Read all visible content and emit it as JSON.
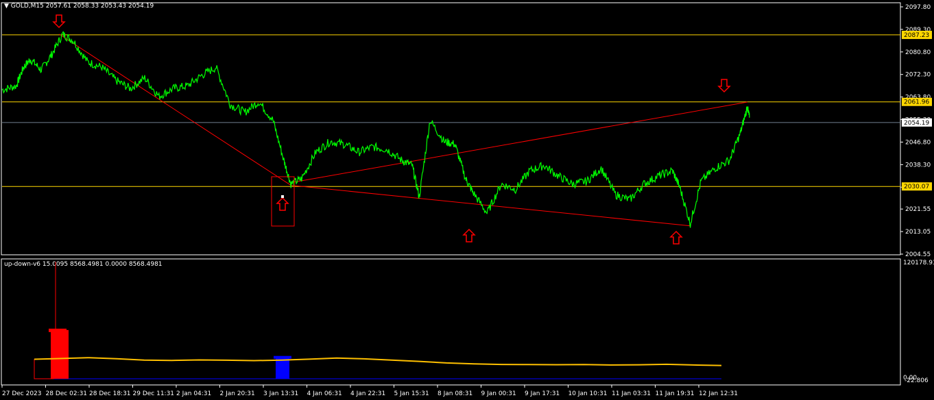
{
  "main_header": {
    "symbol": "GOLD,M15",
    "ohlc": "2057.61 2058.33 2053.43 2054.19"
  },
  "sub_header": {
    "indicator": "up-down-v6",
    "values": "15.0095 8568.4981 0.0000 8568.4981"
  },
  "colors": {
    "background": "#000000",
    "price_line": "#00ff00",
    "level_line": "#ffd700",
    "trend_line": "#ff0000",
    "arrow": "#ff0000",
    "current_price_line": "#708090",
    "ma_line": "#ffc000",
    "hist_up": "#ff0000",
    "hist_down": "#0000ff",
    "axis": "#ffffff"
  },
  "chart_data": [
    {
      "type": "line",
      "name": "main-price",
      "ylim": [
        2004.55,
        2097.8
      ],
      "y_ticks": [
        "2097.80",
        "2089.30",
        "2080.80",
        "2072.30",
        "2063.80",
        "2055.30",
        "2046.80",
        "2038.30",
        "2029.80",
        "2021.55",
        "2013.05",
        "2004.55"
      ],
      "x_ticks": [
        "27 Dec 2023",
        "28 Dec 02:31",
        "28 Dec 18:31",
        "29 Dec 11:31",
        "2 Jan 04:31",
        "2 Jan 20:31",
        "3 Jan 13:31",
        "4 Jan 06:31",
        "4 Jan 22:31",
        "5 Jan 15:31",
        "8 Jan 08:31",
        "9 Jan 00:31",
        "9 Jan 17:31",
        "10 Jan 10:31",
        "11 Jan 03:31",
        "11 Jan 19:31",
        "12 Jan 12:31"
      ],
      "x": [
        0,
        0.02,
        0.03,
        0.04,
        0.055,
        0.07,
        0.085,
        0.1,
        0.12,
        0.14,
        0.16,
        0.18,
        0.2,
        0.22,
        0.24,
        0.26,
        0.28,
        0.3,
        0.32,
        0.34,
        0.36,
        0.38,
        0.395,
        0.405,
        0.42,
        0.44,
        0.46,
        0.48,
        0.5,
        0.52,
        0.54,
        0.56,
        0.575,
        0.585,
        0.6,
        0.62,
        0.635,
        0.65,
        0.66,
        0.68,
        0.7,
        0.72,
        0.74,
        0.76,
        0.78,
        0.8,
        0.82,
        0.84,
        0.86,
        0.88,
        0.9,
        0.92,
        0.94,
        0.95,
        0.965,
        0.98,
        1.0,
        1.02,
        1.035,
        1.045,
        1.048
      ],
      "values": [
        2066.5,
        2068,
        2075,
        2078,
        2074,
        2080,
        2087.5,
        2085,
        2077,
        2075,
        2070,
        2067,
        2071,
        2064,
        2067,
        2068,
        2072,
        2075,
        2061,
        2058,
        2062,
        2055,
        2040,
        2031,
        2033,
        2043,
        2047,
        2046,
        2043,
        2045,
        2044,
        2040,
        2038,
        2026,
        2055,
        2047,
        2046,
        2033,
        2028,
        2020,
        2031,
        2029,
        2036,
        2038,
        2034,
        2031,
        2032,
        2037,
        2027,
        2025,
        2031,
        2034,
        2036,
        2030,
        2016,
        2032,
        2037,
        2040,
        2050,
        2060,
        2056
      ]
    },
    {
      "type": "line",
      "name": "up-down-v6",
      "ylim": [
        -22.806,
        120178.93
      ],
      "y_ticks": [
        "120178.93",
        "0.00",
        "-22.806"
      ],
      "series": [
        {
          "kind": "ma",
          "values": [
            20000,
            20800,
            21600,
            20500,
            19200,
            18800,
            19300,
            19000,
            18600,
            19100,
            20100,
            21200,
            20400,
            19100,
            17800,
            16200,
            15300,
            14700,
            14500,
            14400,
            14600,
            14100,
            14300,
            14800,
            14100,
            13600
          ]
        },
        {
          "kind": "histogram-up",
          "spike_max": 120000,
          "block": 50000
        },
        {
          "kind": "histogram-down",
          "block": 22000
        }
      ]
    }
  ]
}
